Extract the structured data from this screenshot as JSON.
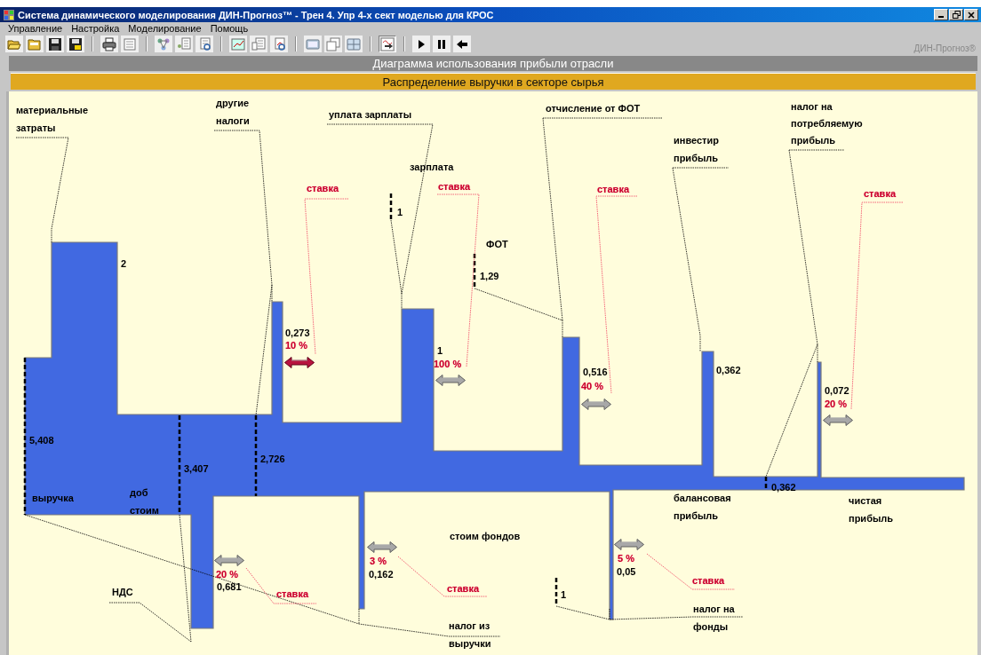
{
  "window": {
    "title": "Система динамического моделирования ДИН-Прогноз™ - Трен 4. Упр 4-х сект моделью для КРОС"
  },
  "menu": [
    "Управление",
    "Настройка",
    "Моделирование",
    "Помощь"
  ],
  "toolbar": [
    {
      "pressed": false
    },
    {
      "pressed": false
    },
    {
      "pressed": false
    },
    {
      "pressed": false
    },
    {
      "pressed": false
    },
    {
      "pressed": false
    },
    {
      "pressed": false
    },
    {
      "pressed": false
    },
    {
      "pressed": false
    },
    {
      "pressed": false
    },
    {
      "pressed": false
    },
    {
      "pressed": false
    },
    {
      "pressed": false
    },
    {
      "pressed": false
    },
    {
      "pressed": false
    },
    {
      "pressed": true
    },
    {
      "pressed": false
    },
    {
      "pressed": false
    },
    {
      "pressed": false
    }
  ],
  "brand": "ДИН-Прогноз®",
  "header": "Диаграмма использования прибыли отрасли",
  "subheader": "Распределение выручки в секторе сырья",
  "labels": [
    "материальные\nзатраты",
    "другие\nналоги",
    "уплата зарплаты",
    "зарплата",
    "ФОТ",
    "отчисление от ФОТ",
    "инвестир\nприбыль",
    "налог на\nпотребляемую\nприбыль",
    "выручка",
    "доб\nстоим",
    "НДС",
    "стоим фондов",
    "налог из\nвыручки",
    "балансовая\nприбыль",
    "налог на\nфонды",
    "чистая\nприбыль"
  ],
  "values": [
    "2",
    "5,408",
    "3,407",
    "2,726",
    "1",
    "1,29",
    "0,362",
    "0,362",
    "1"
  ],
  "rates": [
    {
      "label": "ставка",
      "percent": "10 %",
      "value": "0,273",
      "selected": true
    },
    {
      "label": "ставка",
      "percent": "100 %",
      "value": "1",
      "selected": false
    },
    {
      "label": "ставка",
      "percent": "40 %",
      "value": "0,516",
      "selected": false
    },
    {
      "label": "ставка",
      "percent": "20 %",
      "value": "0,072",
      "selected": false
    },
    {
      "label": "ставка",
      "percent": "20 %",
      "value": "0,681",
      "selected": false
    },
    {
      "label": "ставка",
      "percent": "3 %",
      "value": "0,162",
      "selected": false
    },
    {
      "label": "ставка",
      "percent": "5 %",
      "value": "0,05",
      "selected": false
    }
  ]
}
